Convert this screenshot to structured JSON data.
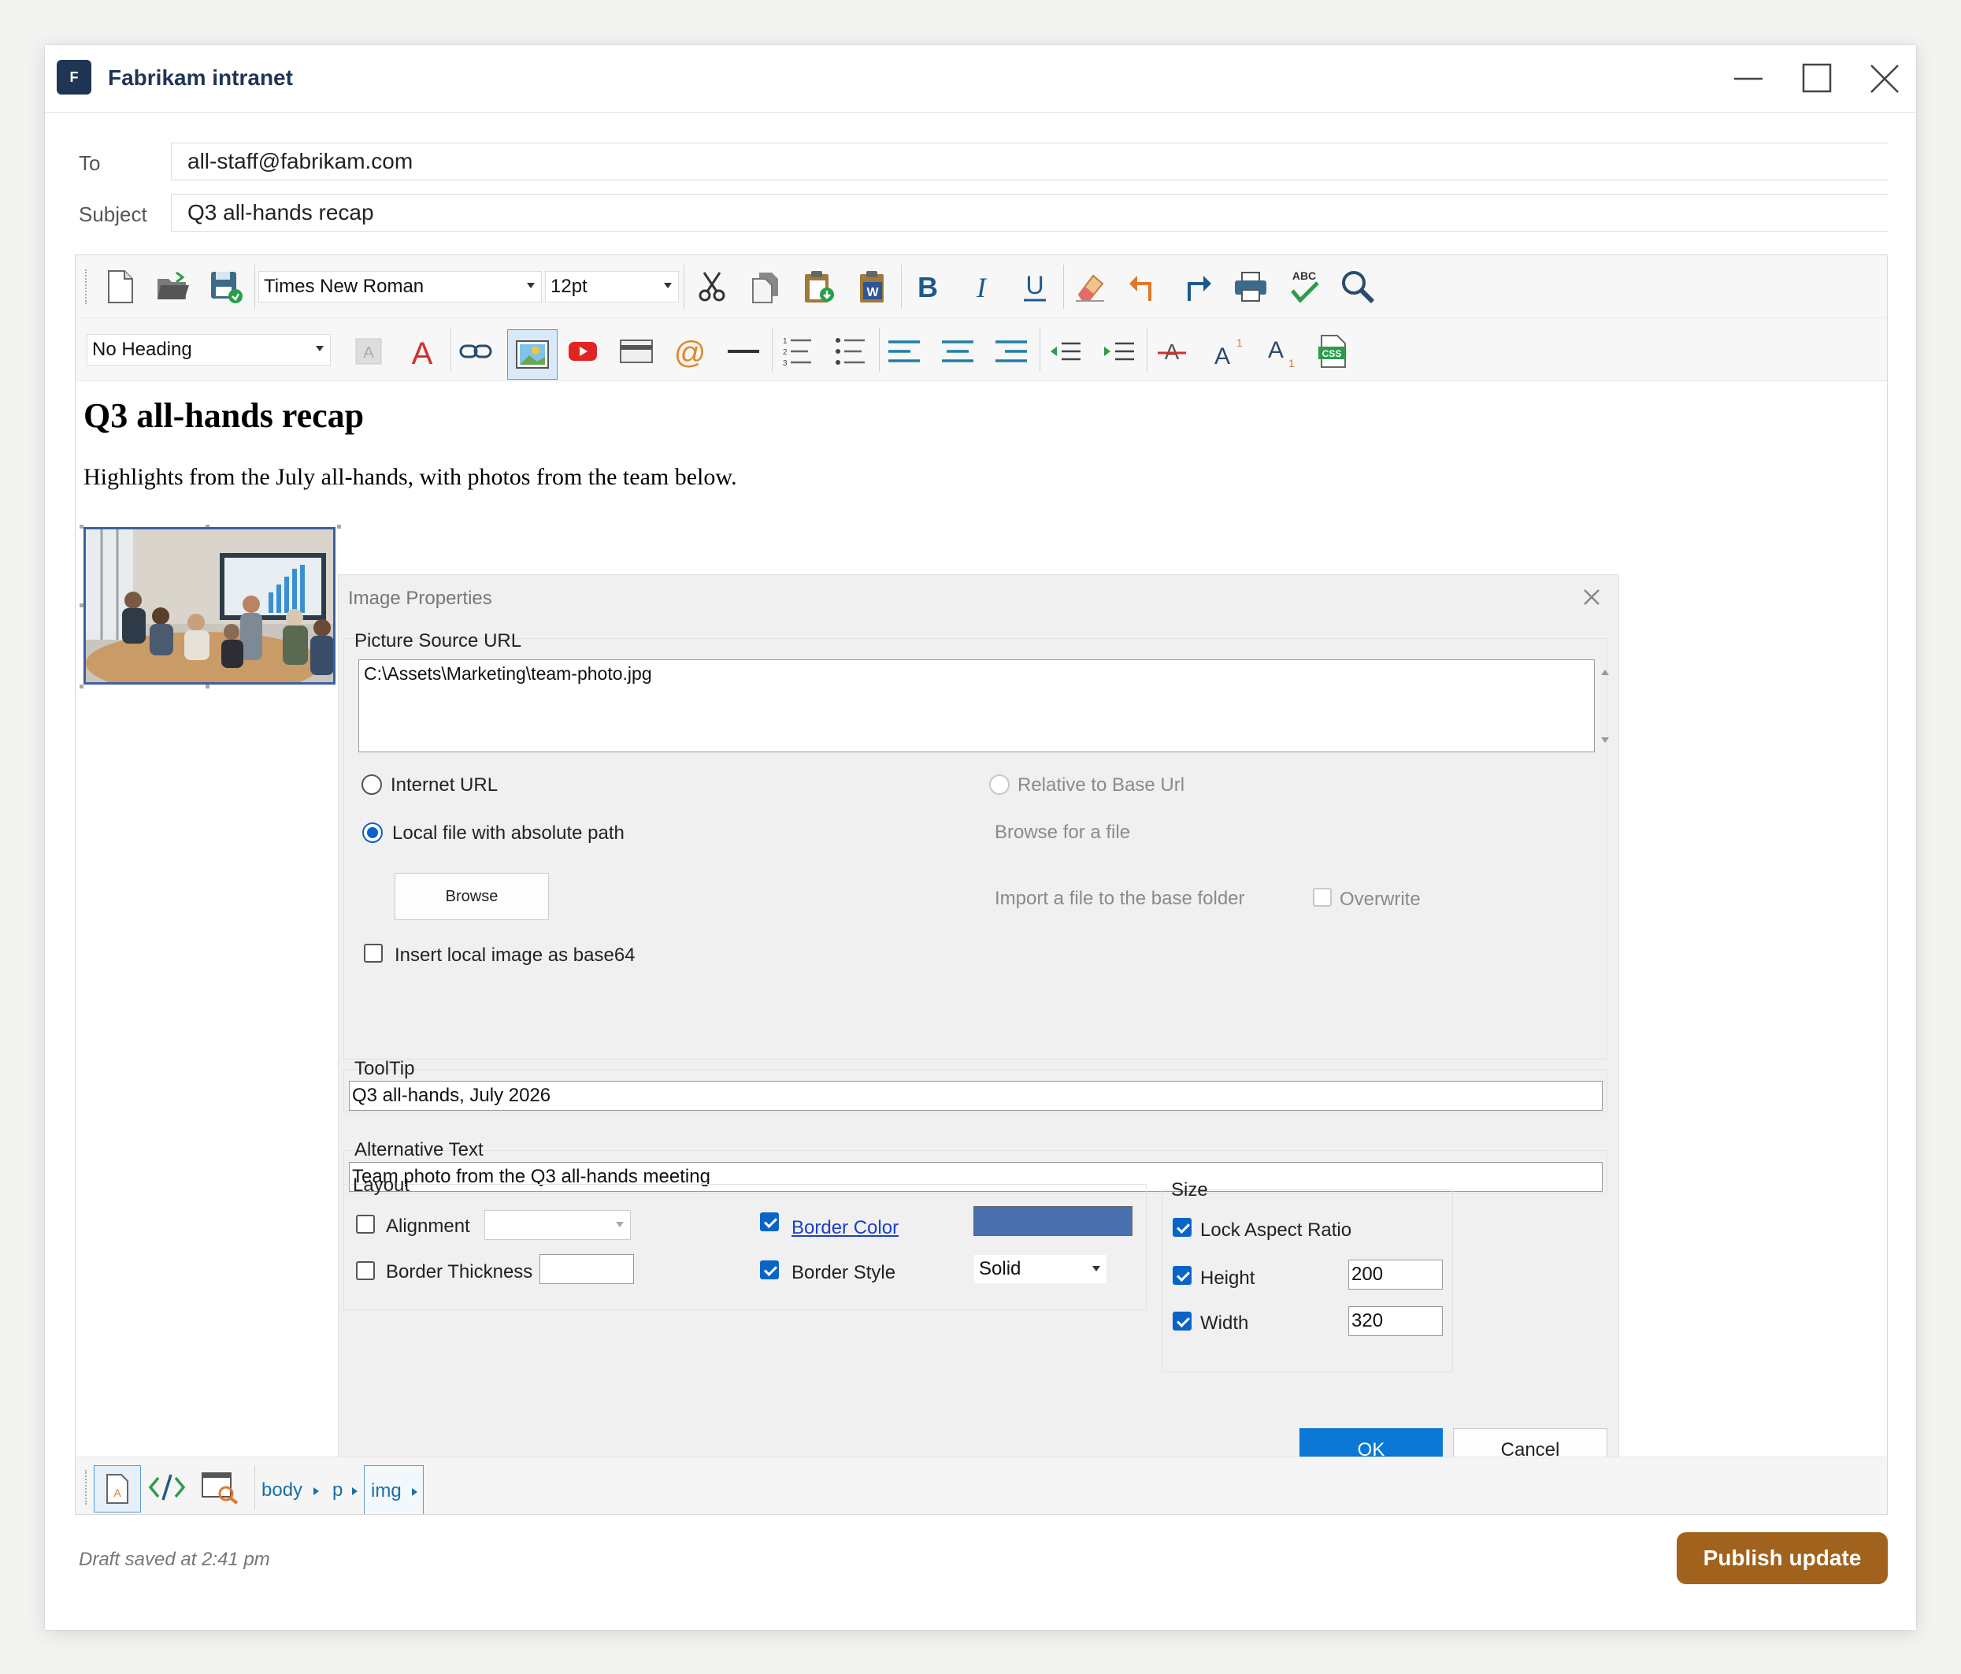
{
  "app": {
    "logo_letter": "F",
    "title": "Fabrikam intranet"
  },
  "compose": {
    "to_label": "To",
    "to_value": "all-staff@fabrikam.com",
    "subject_label": "Subject",
    "subject_value": "Q3 all-hands recap"
  },
  "toolbar": {
    "font_family": "Times New Roman",
    "font_size": "12pt",
    "heading": "No Heading",
    "spellcheck_label": "ABC",
    "css_label": "CSS"
  },
  "document": {
    "heading": "Q3 all-hands recap",
    "paragraph": "Highlights from the July all-hands, with photos from the team below."
  },
  "dialog": {
    "title": "Image Properties",
    "source_group": "Picture Source URL",
    "source_value": "C:\\Assets\\Marketing\\team-photo.jpg",
    "internet_url": "Internet URL",
    "relative_base": "Relative to Base Url",
    "local_file": "Local file with absolute path",
    "browse_for_file": "Browse for a file",
    "browse_button": "Browse",
    "import_file": "Import a file to the base folder",
    "overwrite": "Overwrite",
    "insert_base64": "Insert local image as base64",
    "tooltip_label": "ToolTip",
    "tooltip_value": "Q3 all-hands, July 2026",
    "alt_label": "Alternative Text",
    "alt_value": "Team photo from the Q3 all-hands meeting",
    "layout_label": "Layout",
    "alignment": "Alignment",
    "border_thickness": "Border Thickness",
    "border_color": "Border Color",
    "border_color_value": "#4a70b0",
    "border_style": "Border Style",
    "border_style_value": "Solid",
    "size_label": "Size",
    "lock_aspect": "Lock Aspect Ratio",
    "height_label": "Height",
    "height_value": "200",
    "width_label": "Width",
    "width_value": "320",
    "ok": "OK",
    "cancel": "Cancel"
  },
  "breadcrumb": [
    "body",
    "p",
    "img"
  ],
  "footer": {
    "draft_status": "Draft saved at 2:41 pm",
    "publish": "Publish update"
  },
  "colors": {
    "accent": "#0a78d4",
    "publish": "#a0621c",
    "brand": "#1f3554"
  }
}
